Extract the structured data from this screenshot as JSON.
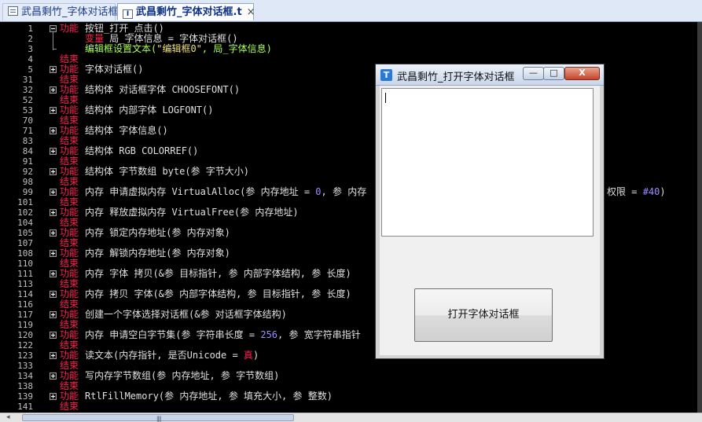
{
  "tabs": [
    {
      "label": "武昌剩竹_字体对话框",
      "active": false
    },
    {
      "label": "武昌剩竹_字体对话框.t",
      "active": true,
      "close": "×"
    }
  ],
  "editor": {
    "lines": [
      {
        "n": "1",
        "fold": "open",
        "kw": "功能",
        "code": "按钮_打开_点击()"
      },
      {
        "n": "2",
        "fold": "",
        "kw": "",
        "code": "变量 局_字体信息 = 字体对话框()"
      },
      {
        "n": "3",
        "fold": "",
        "kw": "",
        "code": "编辑框设置文本(\"编辑框0\", 局_字体信息)"
      },
      {
        "n": "4",
        "fold": "",
        "kw": "结束",
        "code": ""
      },
      {
        "n": "5",
        "fold": "closed",
        "kw": "功能",
        "code": "字体对话框()"
      },
      {
        "n": "31",
        "fold": "",
        "kw": "结束",
        "code": ""
      },
      {
        "n": "32",
        "fold": "closed",
        "kw": "功能",
        "code": "结构体 对话框字体 CHOOSEFONT()"
      },
      {
        "n": "52",
        "fold": "",
        "kw": "结束",
        "code": ""
      },
      {
        "n": "53",
        "fold": "closed",
        "kw": "功能",
        "code": "结构体 内部字体 LOGFONT()"
      },
      {
        "n": "70",
        "fold": "",
        "kw": "结束",
        "code": ""
      },
      {
        "n": "71",
        "fold": "closed",
        "kw": "功能",
        "code": "结构体 字体信息()"
      },
      {
        "n": "83",
        "fold": "",
        "kw": "结束",
        "code": ""
      },
      {
        "n": "84",
        "fold": "closed",
        "kw": "功能",
        "code": "结构体 RGB COLORREF()"
      },
      {
        "n": "91",
        "fold": "",
        "kw": "结束",
        "code": ""
      },
      {
        "n": "92",
        "fold": "closed",
        "kw": "功能",
        "code": "结构体 字节数组 byte(参 字节大小)"
      },
      {
        "n": "98",
        "fold": "",
        "kw": "结束",
        "code": ""
      },
      {
        "n": "99",
        "fold": "closed",
        "kw": "功能",
        "code": "内存 申请虚拟内存 VirtualAlloc(参 内存地址 = 0, 参 内存"
      },
      {
        "n": "101",
        "fold": "",
        "kw": "结束",
        "code": ""
      },
      {
        "n": "102",
        "fold": "closed",
        "kw": "功能",
        "code": "内存 释放虚拟内存 VirtualFree(参 内存地址)"
      },
      {
        "n": "104",
        "fold": "",
        "kw": "结束",
        "code": ""
      },
      {
        "n": "105",
        "fold": "closed",
        "kw": "功能",
        "code": "内存 锁定内存地址(参 内存对象)"
      },
      {
        "n": "107",
        "fold": "",
        "kw": "结束",
        "code": ""
      },
      {
        "n": "108",
        "fold": "closed",
        "kw": "功能",
        "code": "内存 解锁内存地址(参 内存对象)"
      },
      {
        "n": "110",
        "fold": "",
        "kw": "结束",
        "code": ""
      },
      {
        "n": "111",
        "fold": "closed",
        "kw": "功能",
        "code": "内存 字体 拷贝(&参 目标指针, 参 内部字体结构, 参 长度)"
      },
      {
        "n": "113",
        "fold": "",
        "kw": "结束",
        "code": ""
      },
      {
        "n": "114",
        "fold": "closed",
        "kw": "功能",
        "code": "内存 拷贝 字体(&参 内部字体结构, 参 目标指针, 参 长度)"
      },
      {
        "n": "116",
        "fold": "",
        "kw": "结束",
        "code": ""
      },
      {
        "n": "117",
        "fold": "closed",
        "kw": "功能",
        "code": "创建一个字体选择对话框(&参 对话框字体结构)"
      },
      {
        "n": "119",
        "fold": "",
        "kw": "结束",
        "code": ""
      },
      {
        "n": "120",
        "fold": "closed",
        "kw": "功能",
        "code": "内存 申请空白字节集(参 字符串长度 = 256, 参 宽字符串指针"
      },
      {
        "n": "122",
        "fold": "",
        "kw": "结束",
        "code": ""
      },
      {
        "n": "123",
        "fold": "closed",
        "kw": "功能",
        "code": "读文本(内存指针, 是否Unicode = 真)"
      },
      {
        "n": "133",
        "fold": "",
        "kw": "结束",
        "code": ""
      },
      {
        "n": "134",
        "fold": "closed",
        "kw": "功能",
        "code": "写内存字节数组(参 内存地址, 参 字节数组)"
      },
      {
        "n": "138",
        "fold": "",
        "kw": "结束",
        "code": ""
      },
      {
        "n": "139",
        "fold": "closed",
        "kw": "功能",
        "code": "RtlFillMemory(参 内存地址, 参 填充大小, 参 整数)"
      },
      {
        "n": "141",
        "fold": "",
        "kw": "结束",
        "code": ""
      }
    ],
    "overflow_text": "权限 = #40)"
  },
  "dialog": {
    "title": "武昌剩竹_打开字体对话框",
    "icon_glyph": "T",
    "min_glyph": "—",
    "max_glyph": "□",
    "close_glyph": "X",
    "edit_value": "",
    "button_label": "打开字体对话框"
  },
  "colors": {
    "keyword": "#ff2050",
    "editor_bg": "#000000",
    "string": "#f0e070",
    "number": "#9f8aff",
    "statement": "#aaff55"
  }
}
